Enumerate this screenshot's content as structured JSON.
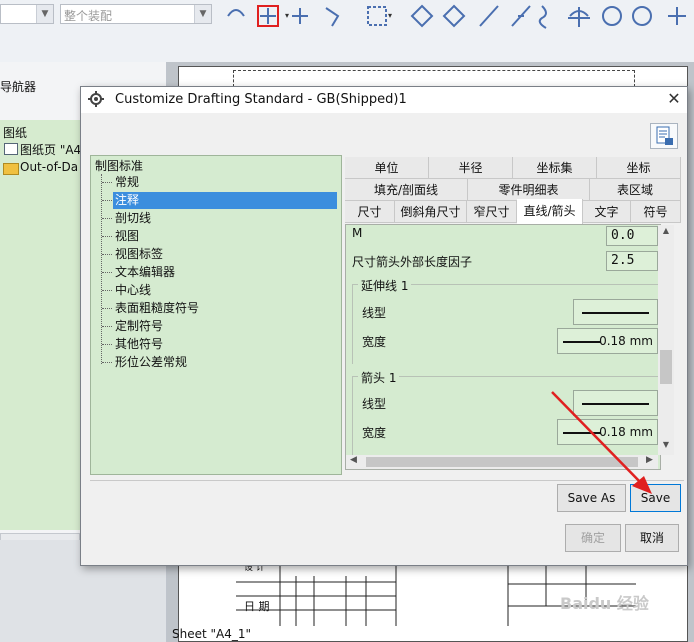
{
  "toolbar": {
    "combo1_value": "",
    "combo2_value": "整个装配",
    "colors": {
      "icon": "#4a6fb0",
      "highlight": "#e02020"
    }
  },
  "navigator": {
    "title": "导航器",
    "items": [
      "图纸",
      "图纸页 \"A4",
      "Out-of-Da"
    ]
  },
  "sheet": {
    "label": "Sheet \"A4_1\"",
    "tb_date": "日 期",
    "tb_cells": [
      "设 计",
      "审 核"
    ]
  },
  "watermark": "Baidu 经验",
  "dialog": {
    "title": "Customize Drafting Standard - GB(Shipped)1",
    "tree": {
      "root": "制图标准",
      "items": [
        "常规",
        "注释",
        "剖切线",
        "视图",
        "视图标签",
        "文本编辑器",
        "中心线",
        "表面粗糙度符号",
        "定制符号",
        "其他符号",
        "形位公差常规"
      ],
      "selected": "注释"
    },
    "tabs": {
      "row1": [
        "单位",
        "半径",
        "坐标集",
        "坐标"
      ],
      "row2": [
        "填充/剖面线",
        "零件明细表",
        "表区域"
      ],
      "row3": [
        "尺寸",
        "倒斜角尺寸",
        "窄尺寸",
        "直线/箭头",
        "文字",
        "符号"
      ],
      "active": "直线/箭头"
    },
    "content": {
      "m_label": "M",
      "m_value": "0.0",
      "factor_label": "尺寸箭头外部长度因子",
      "factor_value": "2.5",
      "ext_group": "延伸线 1",
      "ext_linetype_label": "线型",
      "ext_width_label": "宽度",
      "ext_width_value": "0.18 mm",
      "arrow_group": "箭头 1",
      "arrow_linetype_label": "线型",
      "arrow_width_label": "宽度",
      "arrow_width_value": "0.18 mm"
    },
    "buttons": {
      "save_as": "Save As",
      "save": "Save",
      "ok": "确定",
      "cancel": "取消"
    }
  }
}
